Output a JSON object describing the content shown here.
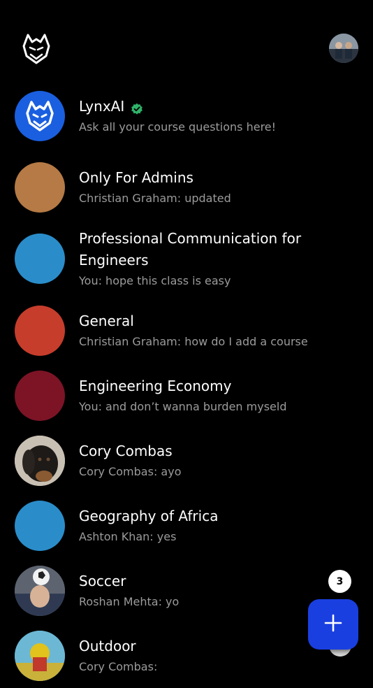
{
  "header": {
    "logo_icon": "lynx-logo-icon",
    "profile_icon": "profile-avatar"
  },
  "chats": [
    {
      "title": "LynxAI",
      "subtitle": "Ask all your course questions here!",
      "avatar_color": "#1a5fe0",
      "verified": true
    },
    {
      "title": "Only For Admins",
      "subtitle": "Christian Graham: updated",
      "avatar_color": "#b57a45"
    },
    {
      "title": "Professional Communication for Engineers",
      "subtitle": "You: hope this class is easy",
      "avatar_color": "#2a8dca"
    },
    {
      "title": "General",
      "subtitle": "Christian Graham: how do I add a course",
      "avatar_color": "#c63d2c"
    },
    {
      "title": "Engineering Economy",
      "subtitle": "You: and don’t wanna burden myseld",
      "avatar_color": "#7c1426"
    },
    {
      "title": "Cory Combas",
      "subtitle": "Cory Combas: ayo",
      "avatar_color": "#3b3632"
    },
    {
      "title": "Geography of Africa",
      "subtitle": "Ashton Khan: yes",
      "avatar_color": "#2a8dca"
    },
    {
      "title": "Soccer",
      "subtitle": "Roshan Mehta: yo",
      "avatar_color": "#6a6f7a"
    },
    {
      "title": "Outdoor",
      "subtitle": "Cory Combas:",
      "avatar_color": "#5aa6c8"
    }
  ],
  "fab": {
    "icon": "plus-icon",
    "color": "#1a3fe0"
  },
  "badge": {
    "count": "3"
  }
}
